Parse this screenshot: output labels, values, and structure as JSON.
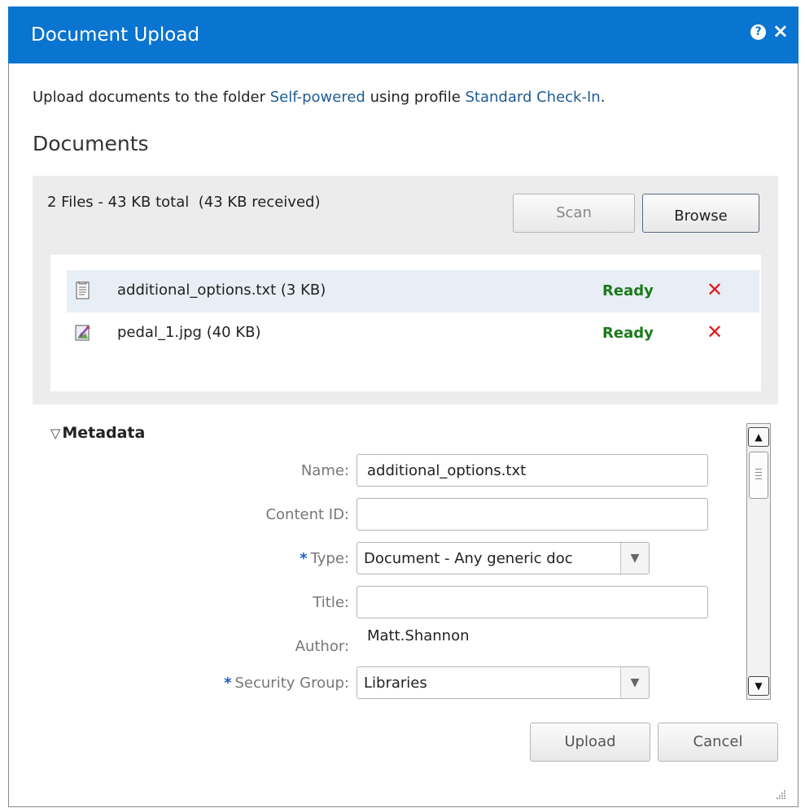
{
  "dialog": {
    "title": "Document Upload",
    "help_icon": "help-icon",
    "close_icon": "close-icon"
  },
  "intro": {
    "prefix": "Upload documents to the folder ",
    "folder_link": "Self-powered",
    "middle": " using profile ",
    "profile_link": "Standard Check-In",
    "suffix": "."
  },
  "section_heading": "Documents",
  "files": {
    "summary": "2 Files - 43 KB total  (43 KB received)",
    "scan_label": "Scan",
    "browse_label": "Browse",
    "items": [
      {
        "name": "additional_options.txt (3 KB)",
        "status": "Ready",
        "icon": "text-file-icon"
      },
      {
        "name": "pedal_1.jpg (40 KB)",
        "status": "Ready",
        "icon": "image-file-icon"
      }
    ],
    "remove_glyph": "✕"
  },
  "metadata": {
    "toggle_glyph": "▽",
    "toggle_label": "Metadata",
    "required_marker": "*",
    "fields": {
      "name_label": "Name:",
      "name_value": "additional_options.txt",
      "content_id_label": "Content ID:",
      "content_id_value": "",
      "type_label": "Type:",
      "type_value": "Document - Any generic doc",
      "title_label": "Title:",
      "title_value": "",
      "author_label": "Author:",
      "author_value": "Matt.Shannon",
      "security_group_label": "Security Group:",
      "security_group_value": "Libraries"
    }
  },
  "footer": {
    "upload_label": "Upload",
    "cancel_label": "Cancel"
  },
  "colors": {
    "titlebar": "#0a74d1",
    "link": "#1e5c94",
    "status_ready": "#1a7a1a",
    "remove": "#e21b1b",
    "required": "#1a5fc4"
  }
}
